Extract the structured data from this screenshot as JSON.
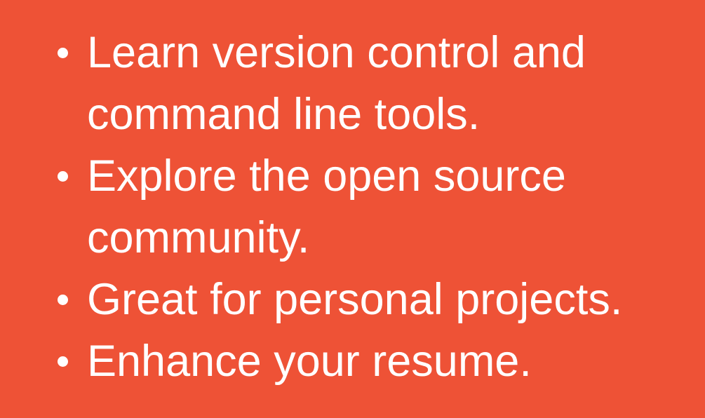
{
  "background_color": "#EE5236",
  "text_color": "#FFFFFF",
  "items": [
    {
      "text": "Learn version control and command line tools."
    },
    {
      "text": "Explore the open source community."
    },
    {
      "text": "Great for personal projects."
    },
    {
      "text": "Enhance your resume."
    }
  ]
}
